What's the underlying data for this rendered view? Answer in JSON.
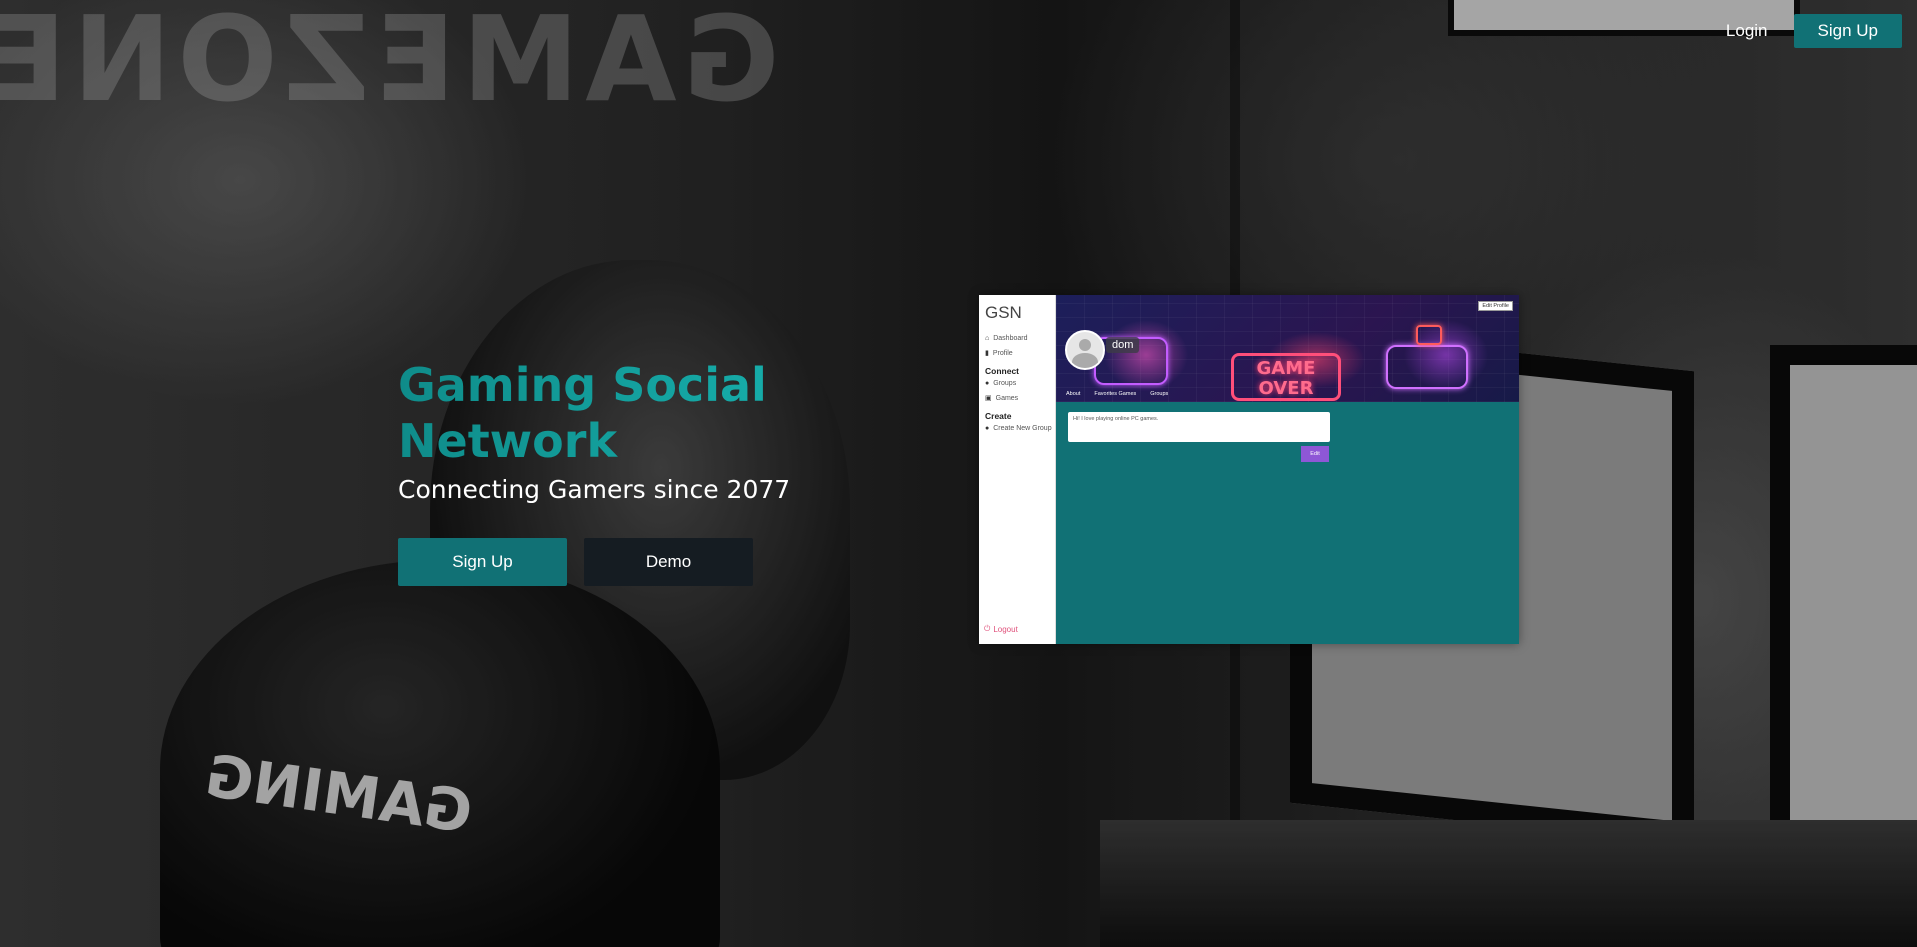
{
  "nav": {
    "login_label": "Login",
    "signup_label": "Sign Up"
  },
  "hero": {
    "title": "Gaming Social Network",
    "subtitle": "Connecting Gamers since 2077",
    "signup_label": "Sign Up",
    "demo_label": "Demo"
  },
  "colors": {
    "accent": "#117175",
    "dark_button": "#151c22",
    "title_gradient_start": "#0f8c8a",
    "title_gradient_end": "#17b0ad",
    "preview_save": "#8e57d6",
    "logout": "#e0517b"
  },
  "preview": {
    "logo": "GSN",
    "nav": [
      {
        "icon": "home-icon",
        "label": "Dashboard"
      },
      {
        "icon": "profile-icon",
        "label": "Profile"
      }
    ],
    "connect_heading": "Connect",
    "connect_items": [
      {
        "icon": "groups-icon",
        "label": "Groups"
      },
      {
        "icon": "gamepad-icon",
        "label": "Games"
      }
    ],
    "create_heading": "Create",
    "create_items": [
      {
        "icon": "groups-icon",
        "label": "Create New Group"
      }
    ],
    "logout_label": "Logout",
    "edit_profile_label": "Edit Profile",
    "username": "dom",
    "banner_text": "GAME OVER",
    "tabs": [
      "About",
      "Favorites Games",
      "Groups"
    ],
    "bio_text": "Hi! I love playing online PC games.",
    "save_label": "Edit"
  }
}
